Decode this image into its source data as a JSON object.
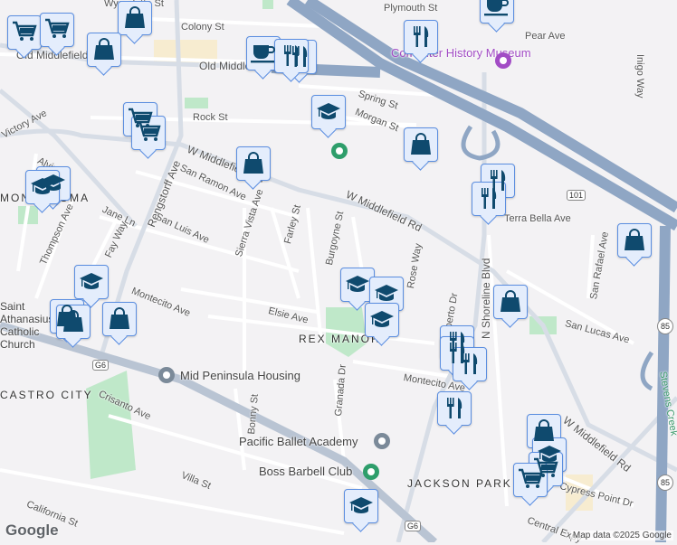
{
  "streets": [
    "Wyandotte St",
    "Colony St",
    "Old Middlefield Way",
    "Old Middlefield Way",
    "Plymouth St",
    "Pear Ave",
    "Inigo Way",
    "Spring St",
    "Morgan St",
    "Rock St",
    "Victory Ave",
    "Alvin St",
    "W Middlefield Rd",
    "San Ramon Ave",
    "Rengstorff Ave",
    "Jane Ln",
    "San Luis Ave",
    "Sierra Vista Ave",
    "Farley St",
    "Burgoyne St",
    "Thompson Ave",
    "Fay Way",
    "Montecito Ave",
    "Elsie Ave",
    "Terra Bella Ave",
    "San Rafael Ave",
    "San Lucas Ave",
    "W Middlefield Rd",
    "W Middlefield Rd",
    "Montecito Ave",
    "Crisanto Ave",
    "Bonny St",
    "Granada Dr",
    "Villa St",
    "California St",
    "Cypress Point Dr",
    "Central Expy",
    "N Shoreline Blvd",
    "Stevens Creek",
    "Rose Way",
    "Alberto Dr"
  ],
  "areas": {
    "rex_manor": "REX MANOR",
    "monta_loma": "MONTA LOMA",
    "castro_city": "CASTRO CITY",
    "jackson_park": "JACKSON PARK",
    "athanasius": "Saint Athanasius Catholic Church"
  },
  "pois": {
    "museum": "Computer History Museum",
    "housing": "Mid Peninsula Housing",
    "ballet": "Pacific Ballet Academy",
    "barbell": "Boss Barbell Club"
  },
  "shields": {
    "us101": "101",
    "ca85": "85",
    "g6": "G6"
  },
  "colors": {
    "marker_fill": "#e4edfc",
    "marker_border": "#5b8ee0",
    "icon": "#0f4a6e",
    "highway": "#8fa6c4",
    "park": "#bfe8c9"
  },
  "attribution": "Map data ©2025 Google",
  "logo": "Google"
}
